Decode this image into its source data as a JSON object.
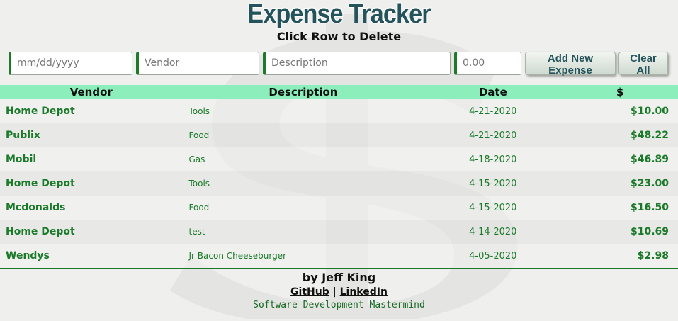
{
  "header": {
    "title": "Expense Tracker",
    "subtitle": "Click Row to Delete"
  },
  "form": {
    "date_placeholder": "mm/dd/yyyy",
    "vendor_placeholder": "Vendor",
    "description_placeholder": "Description",
    "amount_placeholder": "0.00",
    "add_label": "Add New Expense",
    "clear_label": "Clear All"
  },
  "table": {
    "headers": [
      "Vendor",
      "Description",
      "Date",
      "$"
    ],
    "rows": [
      {
        "vendor": "Home Depot",
        "description": "Tools",
        "date": "4-21-2020",
        "amount": "$10.00"
      },
      {
        "vendor": "Publix",
        "description": "Food",
        "date": "4-21-2020",
        "amount": "$48.22"
      },
      {
        "vendor": "Mobil",
        "description": "Gas",
        "date": "4-18-2020",
        "amount": "$46.89"
      },
      {
        "vendor": "Home Depot",
        "description": "Tools",
        "date": "4-15-2020",
        "amount": "$23.00"
      },
      {
        "vendor": "Mcdonalds",
        "description": "Food",
        "date": "4-15-2020",
        "amount": "$16.50"
      },
      {
        "vendor": "Home Depot",
        "description": "test",
        "date": "4-14-2020",
        "amount": "$10.69"
      },
      {
        "vendor": "Wendys",
        "description": "Jr Bacon Cheeseburger",
        "date": "4-05-2020",
        "amount": "$2.98"
      }
    ]
  },
  "footer": {
    "byline": "by Jeff King",
    "github_label": "GitHub",
    "separator": "|",
    "linkedin_label": "LinkedIn",
    "brand": "Software Development Mastermind"
  },
  "colors": {
    "title": "#24535b",
    "header_row": "#8ceebb",
    "accent_green": "#1a7a2a"
  },
  "icons": {
    "watermark": "dollar-sign-icon"
  }
}
